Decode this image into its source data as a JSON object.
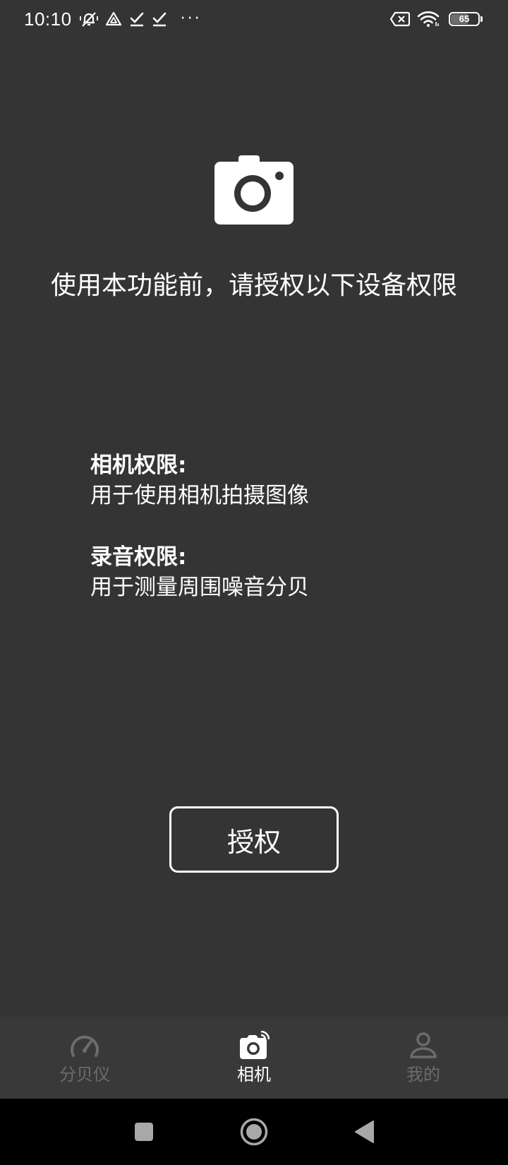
{
  "status_bar": {
    "time": "10:10",
    "icons": [
      "muted-bell-icon",
      "drive-icon",
      "check-icon",
      "check-icon",
      "more-dots-icon",
      "no-sim-icon",
      "wifi-icon"
    ],
    "more_dots": "···",
    "battery_level": "65",
    "battery_fraction": 0.65
  },
  "main": {
    "icon": "camera-icon",
    "headline": "使用本功能前，请授权以下设备权限",
    "permissions": [
      {
        "title": "相机权限:",
        "description": "用于使用相机拍摄图像"
      },
      {
        "title": "录音权限:",
        "description": "用于测量周围噪音分贝"
      }
    ],
    "authorize_label": "授权"
  },
  "bottom_nav": {
    "items": [
      {
        "label": "分贝仪",
        "icon": "speedometer-icon",
        "active": false
      },
      {
        "label": "相机",
        "icon": "camera-icon",
        "active": true
      },
      {
        "label": "我的",
        "icon": "person-icon",
        "active": false
      }
    ]
  },
  "system_nav": {
    "buttons": [
      "recents-square-icon",
      "home-circle-icon",
      "back-triangle-icon"
    ]
  },
  "colors": {
    "background": "#343434",
    "bottom_nav_background": "#393939",
    "active": "#ffffff",
    "inactive": "#6c6c6c",
    "system_nav_background": "#000000"
  }
}
